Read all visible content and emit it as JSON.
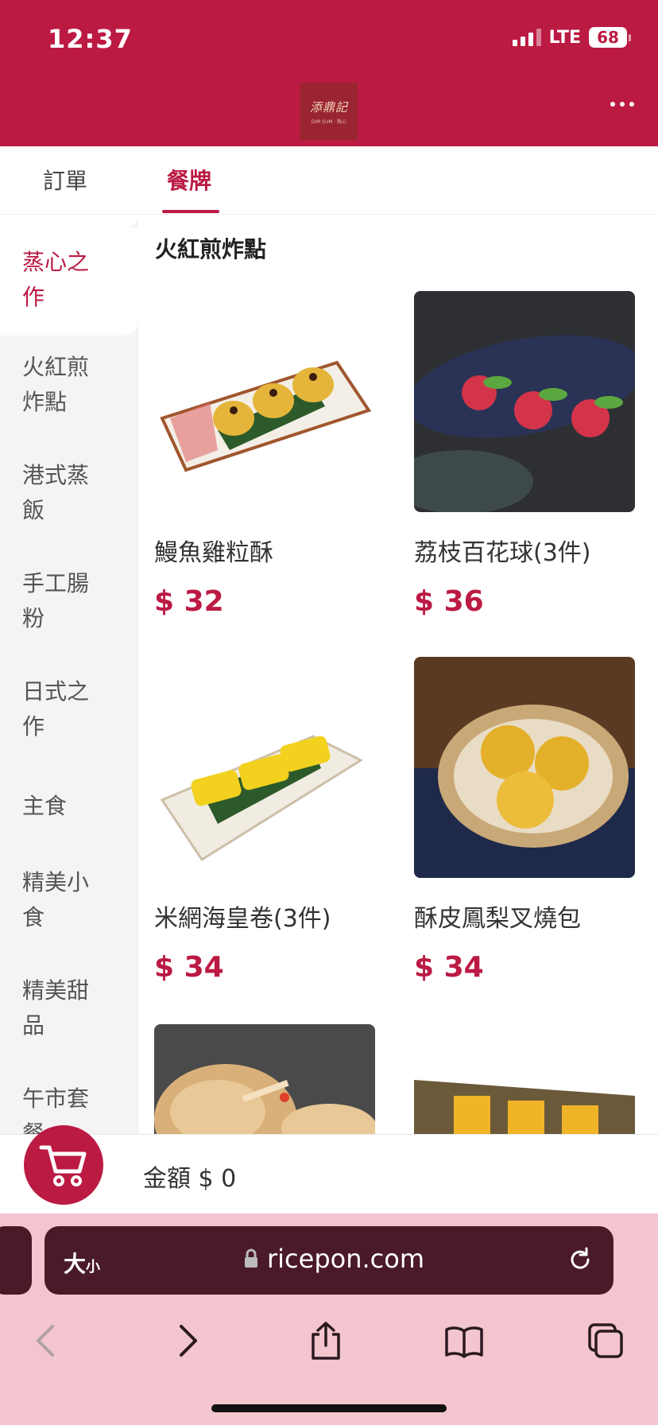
{
  "status_bar": {
    "time": "12:37",
    "network": "LTE",
    "battery": "68"
  },
  "header": {
    "logo_text": "添鼎記",
    "logo_sub": "DIM SUM · 點心"
  },
  "tabs": [
    {
      "label": "訂單",
      "active": false
    },
    {
      "label": "餐牌",
      "active": true
    }
  ],
  "sidebar": {
    "items": [
      {
        "label": "蒸心之作",
        "active": true
      },
      {
        "label": "火紅煎炸點",
        "active": false
      },
      {
        "label": "港式蒸飯",
        "active": false
      },
      {
        "label": "手工腸粉",
        "active": false
      },
      {
        "label": "日式之作",
        "active": false
      },
      {
        "label": "主食",
        "active": false
      },
      {
        "label": "精美小食",
        "active": false
      },
      {
        "label": "精美甜品",
        "active": false
      },
      {
        "label": "午市套餐",
        "active": false
      }
    ]
  },
  "section": {
    "title": "火紅煎炸點"
  },
  "products": [
    {
      "name": "鰻魚雞粒酥",
      "price": "$ 32"
    },
    {
      "name": "荔枝百花球(3件)",
      "price": "$ 36"
    },
    {
      "name": "米網海皇卷(3件)",
      "price": "$ 34"
    },
    {
      "name": "酥皮鳳梨叉燒包",
      "price": "$ 34"
    }
  ],
  "cart": {
    "total_label": "金額 $ 0"
  },
  "browser": {
    "text_size_big": "大",
    "text_size_small": "小",
    "url": "ricepon.com"
  },
  "colors": {
    "brand": "#bb1a43",
    "browser_bar": "#4a1a28",
    "browser_bg": "#f3c5cf"
  }
}
